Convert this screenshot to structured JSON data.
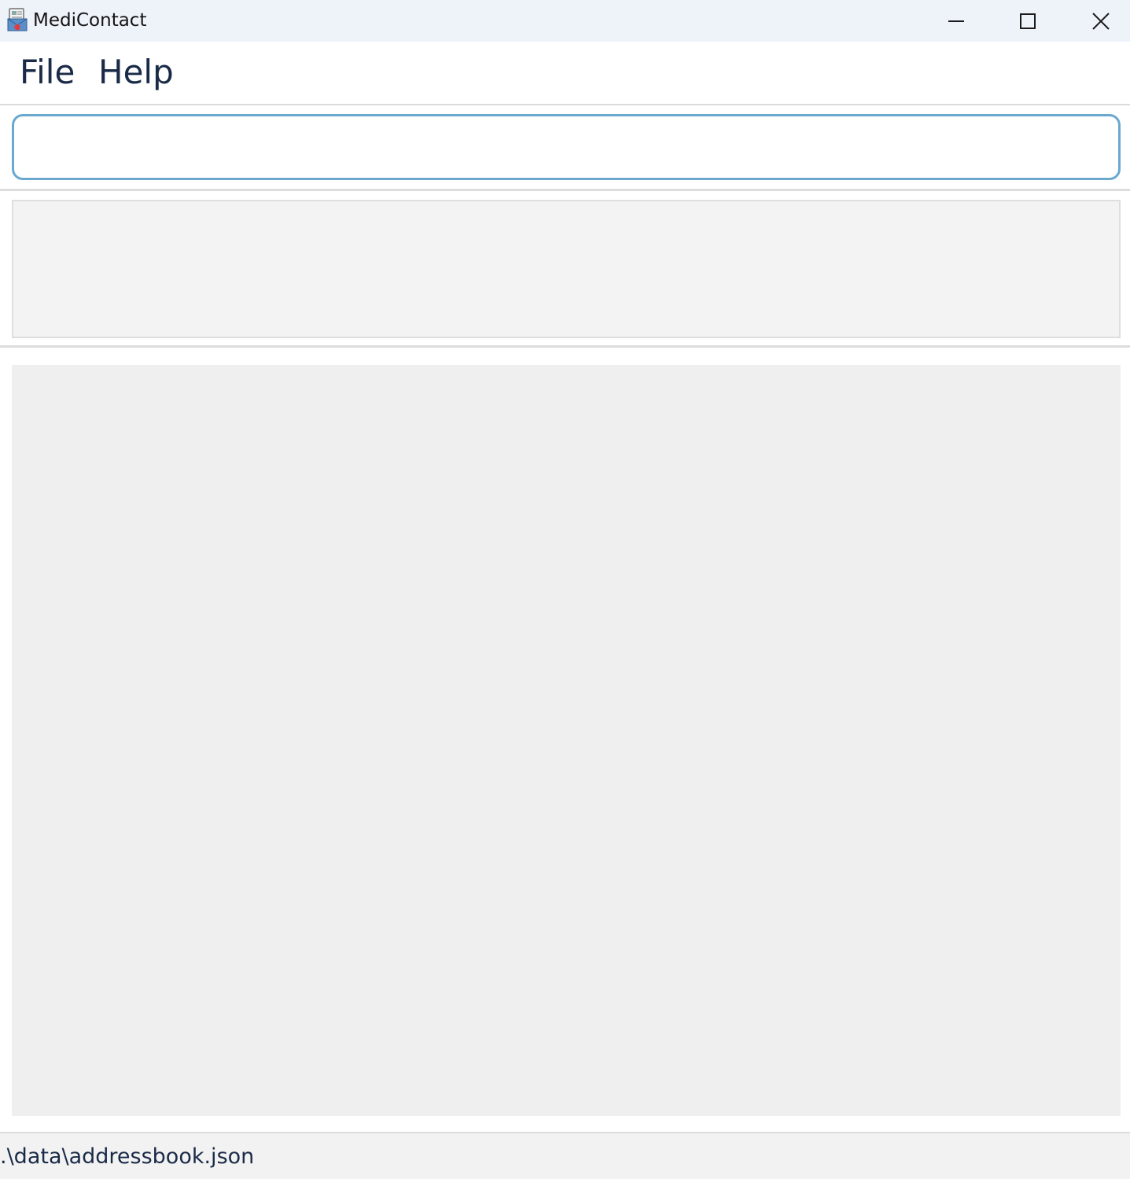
{
  "window": {
    "title": "MediContact",
    "icon": "medicontact-app-icon",
    "controls": {
      "minimize_icon": "minimize-icon",
      "maximize_icon": "maximize-icon",
      "close_icon": "close-icon"
    }
  },
  "menu": {
    "items": [
      {
        "label": "File"
      },
      {
        "label": "Help"
      }
    ]
  },
  "command_box": {
    "value": "",
    "placeholder": "",
    "border_color": "#6aa8d0"
  },
  "result_display": {
    "text": ""
  },
  "person_list": {
    "items": []
  },
  "status_bar": {
    "save_location": ".\\data\\addressbook.json"
  },
  "colors": {
    "titlebar_bg": "#eef2f9",
    "text": "#1a2b48",
    "result_bg": "#f3f3f3",
    "list_bg": "#efefef",
    "status_bg": "#f2f2f2"
  }
}
